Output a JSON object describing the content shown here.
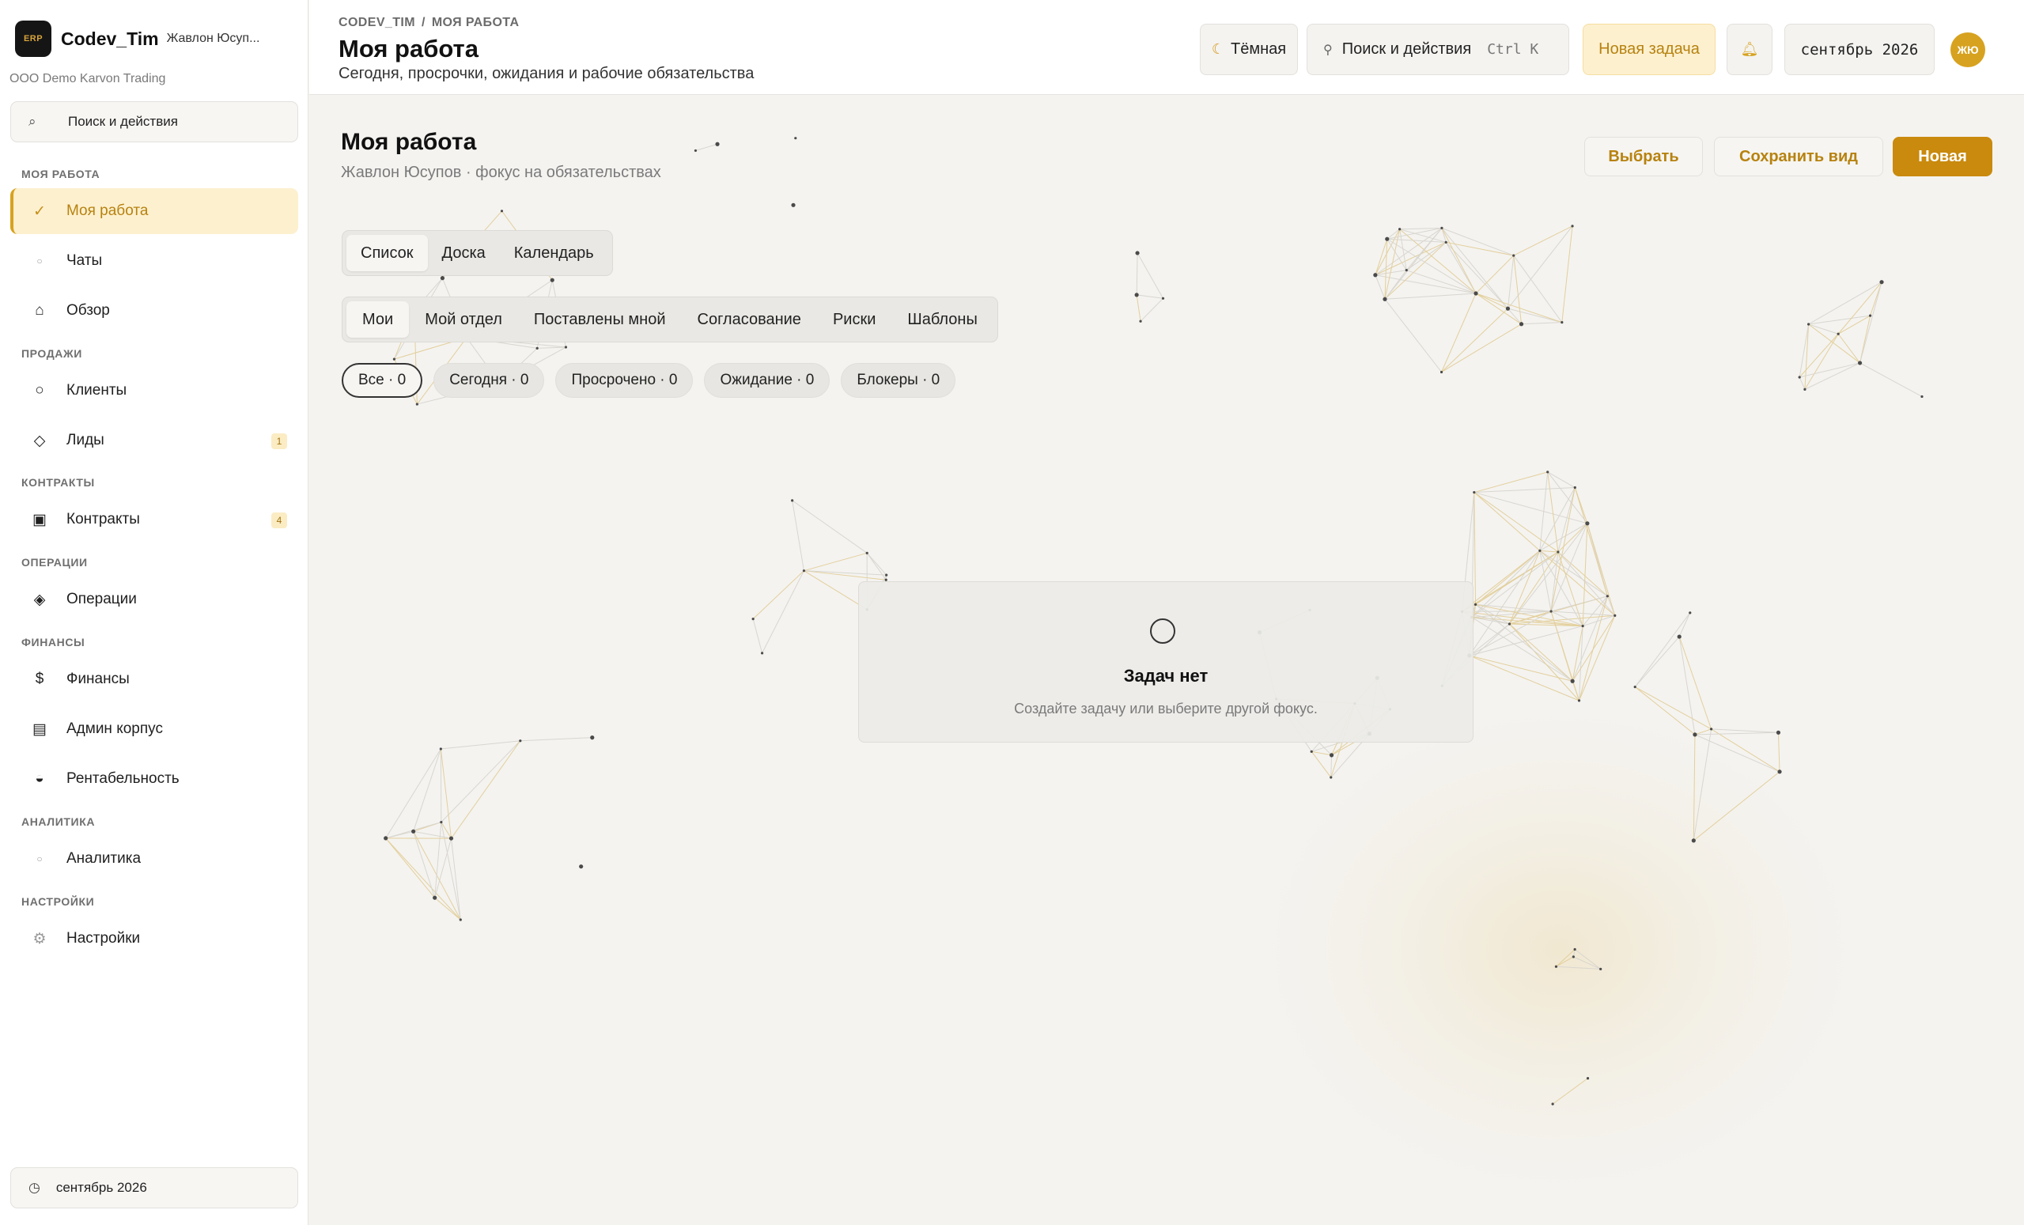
{
  "brand": {
    "name": "Codev_Tim",
    "user": "Жавлон Юсуп...",
    "org": "ООО Demo Karvon Trading",
    "logo_text": "ERP"
  },
  "sidebar": {
    "search_label": "Поиск и действия",
    "sections": {
      "my_work": "МОЯ РАБОТА",
      "sales": "ПРОДАЖИ",
      "contracts": "КОНТРАКТЫ",
      "operations": "ОПЕРАЦИИ",
      "finance": "ФИНАНСЫ",
      "analytics": "АНАЛИТИКА",
      "settings": "НАСТРОЙКИ"
    },
    "items": {
      "my_work": "Моя работа",
      "chats": "Чаты",
      "overview": "Обзор",
      "clients": "Клиенты",
      "leads": "Лиды",
      "leads_badge": "1",
      "contracts": "Контракты",
      "contracts_badge": "4",
      "operations": "Операции",
      "finance": "Финансы",
      "admin": "Админ корпус",
      "profitability": "Рентабельность",
      "analytics": "Аналитика",
      "settings": "Настройки"
    },
    "footer_date": "сентябрь 2026"
  },
  "header": {
    "crumb_org": "CODEV_TIM",
    "crumb_sep": "/",
    "crumb_page": "МОЯ РАБОТА",
    "title": "Моя работа",
    "subtitle": "Сегодня, просрочки, ожидания и рабочие обязательства",
    "theme_label": "Тёмная",
    "search_label": "Поиск и действия",
    "search_shortcut": "Ctrl K",
    "new_task_label": "Новая задача",
    "date_label": "сентябрь 2026",
    "avatar_initials": "ЖЮ"
  },
  "main": {
    "title": "Моя работа",
    "subtitle": "Жавлон Юсупов · фокус на обязательствах",
    "actions": {
      "select": "Выбрать",
      "save_view": "Сохранить вид",
      "new": "Новая"
    },
    "view_tabs": [
      "Список",
      "Доска",
      "Календарь"
    ],
    "focus_tabs": [
      "Мои",
      "Мой отдел",
      "Поставлены мной",
      "Согласование",
      "Риски",
      "Шаблоны"
    ],
    "filters": [
      "Все · 0",
      "Сегодня · 0",
      "Просрочено · 0",
      "Ожидание · 0",
      "Блокеры · 0"
    ],
    "empty": {
      "title": "Задач нет",
      "text": "Создайте задачу или выберите другой фокус."
    }
  },
  "colors": {
    "accent": "#c98a0e",
    "accent_soft": "#fdf0cf",
    "background": "#f4f3f0"
  }
}
